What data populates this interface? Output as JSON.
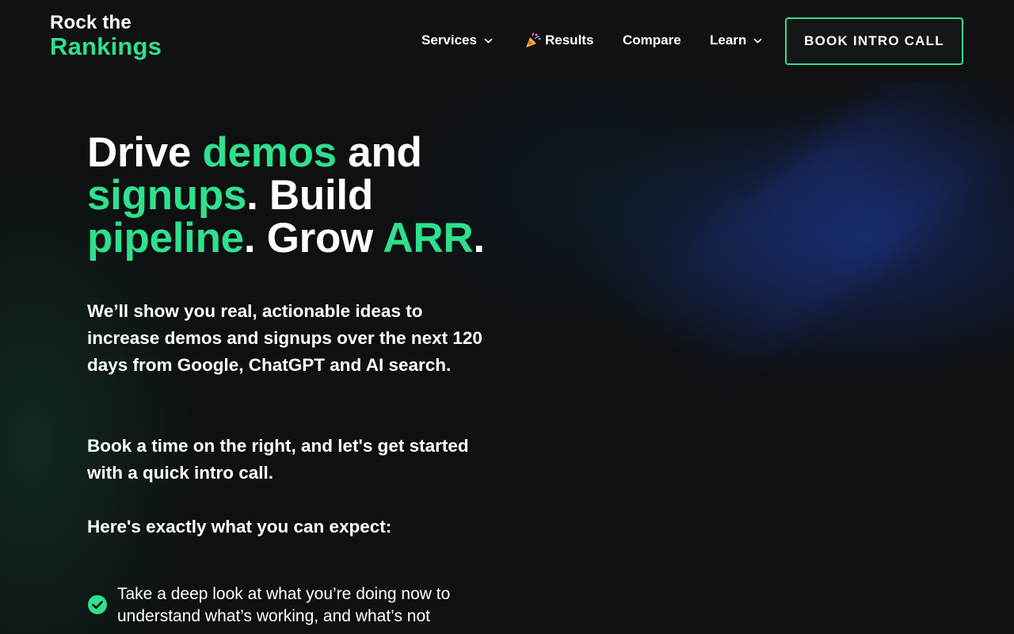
{
  "logo": {
    "line1": "Rock the",
    "line2": "Rankings"
  },
  "nav": {
    "services_label": "Services",
    "results_label": "Results",
    "compare_label": "Compare",
    "learn_label": "Learn",
    "cta_label": "BOOK INTRO CALL"
  },
  "hero": {
    "w1": "Drive ",
    "g1": "demos",
    "w2": " and",
    "g2": "signups",
    "w3": ". Build",
    "g3": "pipeline",
    "w4": ". Grow ",
    "g4": "ARR",
    "w5": "."
  },
  "body": {
    "intro": "We’ll show you real, actionable ideas to increase demos and signups over the next 120 days from Google, ChatGPT and AI search.",
    "book": "Book a time on the right, and let's get started with a quick intro call.",
    "expect": "Here's exactly what you can expect:",
    "bullet1": "Take a deep look at what you’re doing now to understand what’s working, and what’s not"
  },
  "colors": {
    "accent": "#2fe08c",
    "background": "#0e1012",
    "nav_background": "#101112"
  },
  "icons": {
    "chevron": "chevron-down-icon",
    "party": "party-popper-icon",
    "check": "check-circle-icon"
  }
}
